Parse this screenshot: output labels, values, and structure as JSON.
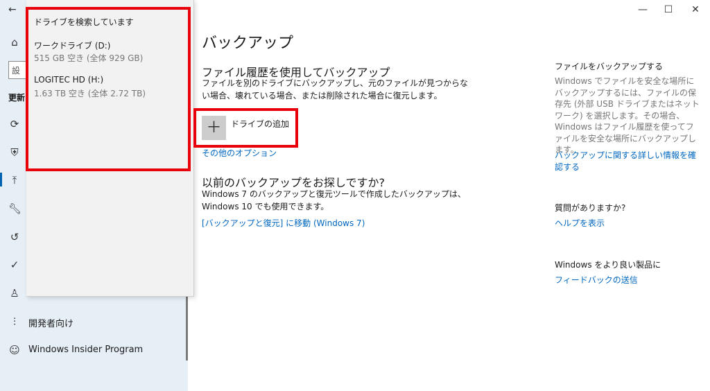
{
  "nav": {
    "search_placeholder": "設",
    "section_title": "更新",
    "items": [
      {
        "label": "開発者向け",
        "icon": "developer-icon"
      },
      {
        "label": "Windows Insider Program",
        "icon": "insider-cat-icon"
      }
    ]
  },
  "flyout": {
    "title": "ドライブを検索しています",
    "drives": [
      {
        "name": "ワークドライブ (D:)",
        "detail": "515 GB 空き (全体 929 GB)"
      },
      {
        "name": "LOGITEC HD (H:)",
        "detail": "1.63 TB 空き (全体 2.72 TB)"
      }
    ]
  },
  "main": {
    "title": "バックアップ",
    "file_history": {
      "heading": "ファイル履歴を使用してバックアップ",
      "description": "ファイルを別のドライブにバックアップし、元のファイルが見つからない場合、壊れている場合、または削除された場合に復元します。",
      "add_drive_label": "ドライブの追加",
      "more_options": "その他のオプション"
    },
    "older": {
      "heading": "以前のバックアップをお探しですか?",
      "description": "Windows 7 のバックアップと復元ツールで作成したバックアップは、Windows 10 でも使用できます。",
      "link": "[バックアップと復元] に移動 (Windows 7)"
    }
  },
  "right": {
    "backup_title": "ファイルをバックアップする",
    "backup_text": "Windows でファイルを安全な場所にバックアップするには、ファイルの保存先 (外部 USB ドライブまたはネットワーク) を選択します。その場合、Windows はファイル履歴を使ってファイルを安全な場所にバックアップします。",
    "backup_link": "バックアップに関する詳しい情報を確認する",
    "question_title": "質問がありますか?",
    "help_link": "ヘルプを表示",
    "improve_title": "Windows をより良い製品に",
    "feedback_link": "フィードバックの送信"
  },
  "colors": {
    "accent": "#0067c0",
    "highlight": "#e8000b",
    "nav_bg": "#e6eef6"
  }
}
